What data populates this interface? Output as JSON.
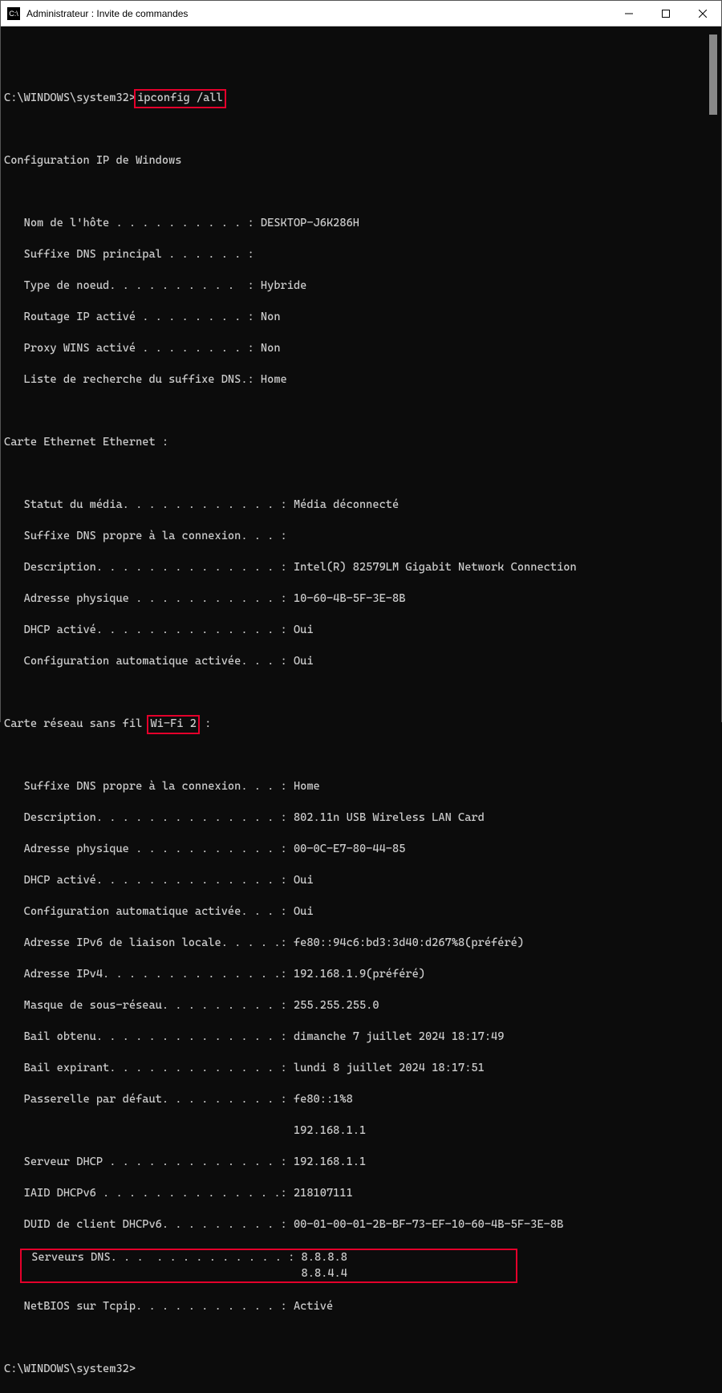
{
  "window": {
    "title": "Administrateur : Invite de commandes"
  },
  "prompt1": "C:\\WINDOWS\\system32>",
  "command": "ipconfig /all",
  "header": "Configuration IP de Windows",
  "hostSettings": {
    "hostname": "   Nom de l'hôte . . . . . . . . . . : DESKTOP-J6K286H",
    "primarySuffix": "   Suffixe DNS principal . . . . . . :",
    "nodeType": "   Type de noeud. . . . . . . . . .  : Hybride",
    "ipRouting": "   Routage IP activé . . . . . . . . : Non",
    "winsProxy": "   Proxy WINS activé . . . . . . . . : Non",
    "searchList": "   Liste de recherche du suffixe DNS.: Home"
  },
  "ethHeader": "Carte Ethernet Ethernet :",
  "eth": {
    "status": "   Statut du média. . . . . . . . . . . . : Média déconnecté",
    "suffix": "   Suffixe DNS propre à la connexion. . . :",
    "desc": "   Description. . . . . . . . . . . . . . : Intel(R) 82579LM Gigabit Network Connection",
    "mac": "   Adresse physique . . . . . . . . . . . : 10-60-4B-5F-3E-8B",
    "dhcp": "   DHCP activé. . . . . . . . . . . . . . : Oui",
    "autoconf": "   Configuration automatique activée. . . : Oui"
  },
  "wifiHeaderPre": "Carte réseau sans fil ",
  "wifiName": "Wi-Fi 2",
  "wifiHeaderPost": " :",
  "wifi": {
    "suffix": "   Suffixe DNS propre à la connexion. . . : Home",
    "desc": "   Description. . . . . . . . . . . . . . : 802.11n USB Wireless LAN Card",
    "mac": "   Adresse physique . . . . . . . . . . . : 00-0C-E7-80-44-85",
    "dhcp": "   DHCP activé. . . . . . . . . . . . . . : Oui",
    "autoconf": "   Configuration automatique activée. . . : Oui",
    "ipv6": "   Adresse IPv6 de liaison locale. . . . .: fe80::94c6:bd3:3d40:d267%8(préféré)",
    "ipv4": "   Adresse IPv4. . . . . . . . . . . . . .: 192.168.1.9(préféré)",
    "mask": "   Masque de sous-réseau. . . . . . . . . : 255.255.255.0",
    "lease": "   Bail obtenu. . . . . . . . . . . . . . : dimanche 7 juillet 2024 18:17:49",
    "leaseExp": "   Bail expirant. . . . . . . . . . . . . : lundi 8 juillet 2024 18:17:51",
    "gateway": "   Passerelle par défaut. . . . . . . . . : fe80::1%8",
    "gateway2": "                                            192.168.1.1",
    "dhcpSrv": "   Serveur DHCP . . . . . . . . . . . . . : 192.168.1.1",
    "iaid": "   IAID DHCPv6 . . . . . . . . . . . . . .: 218107111",
    "duid": "   DUID de client DHCPv6. . . . . . . . . : 00-01-00-01-2B-BF-73-EF-10-60-4B-5F-3E-8B",
    "dns1": " Serveurs DNS. . .  . . . . . . . . . . : 8.8.8.8",
    "dns2": "                                          8.8.4.4",
    "netbios": "   NetBIOS sur Tcpip. . . . . . . . . . . : Activé"
  },
  "prompt2": "C:\\WINDOWS\\system32>"
}
